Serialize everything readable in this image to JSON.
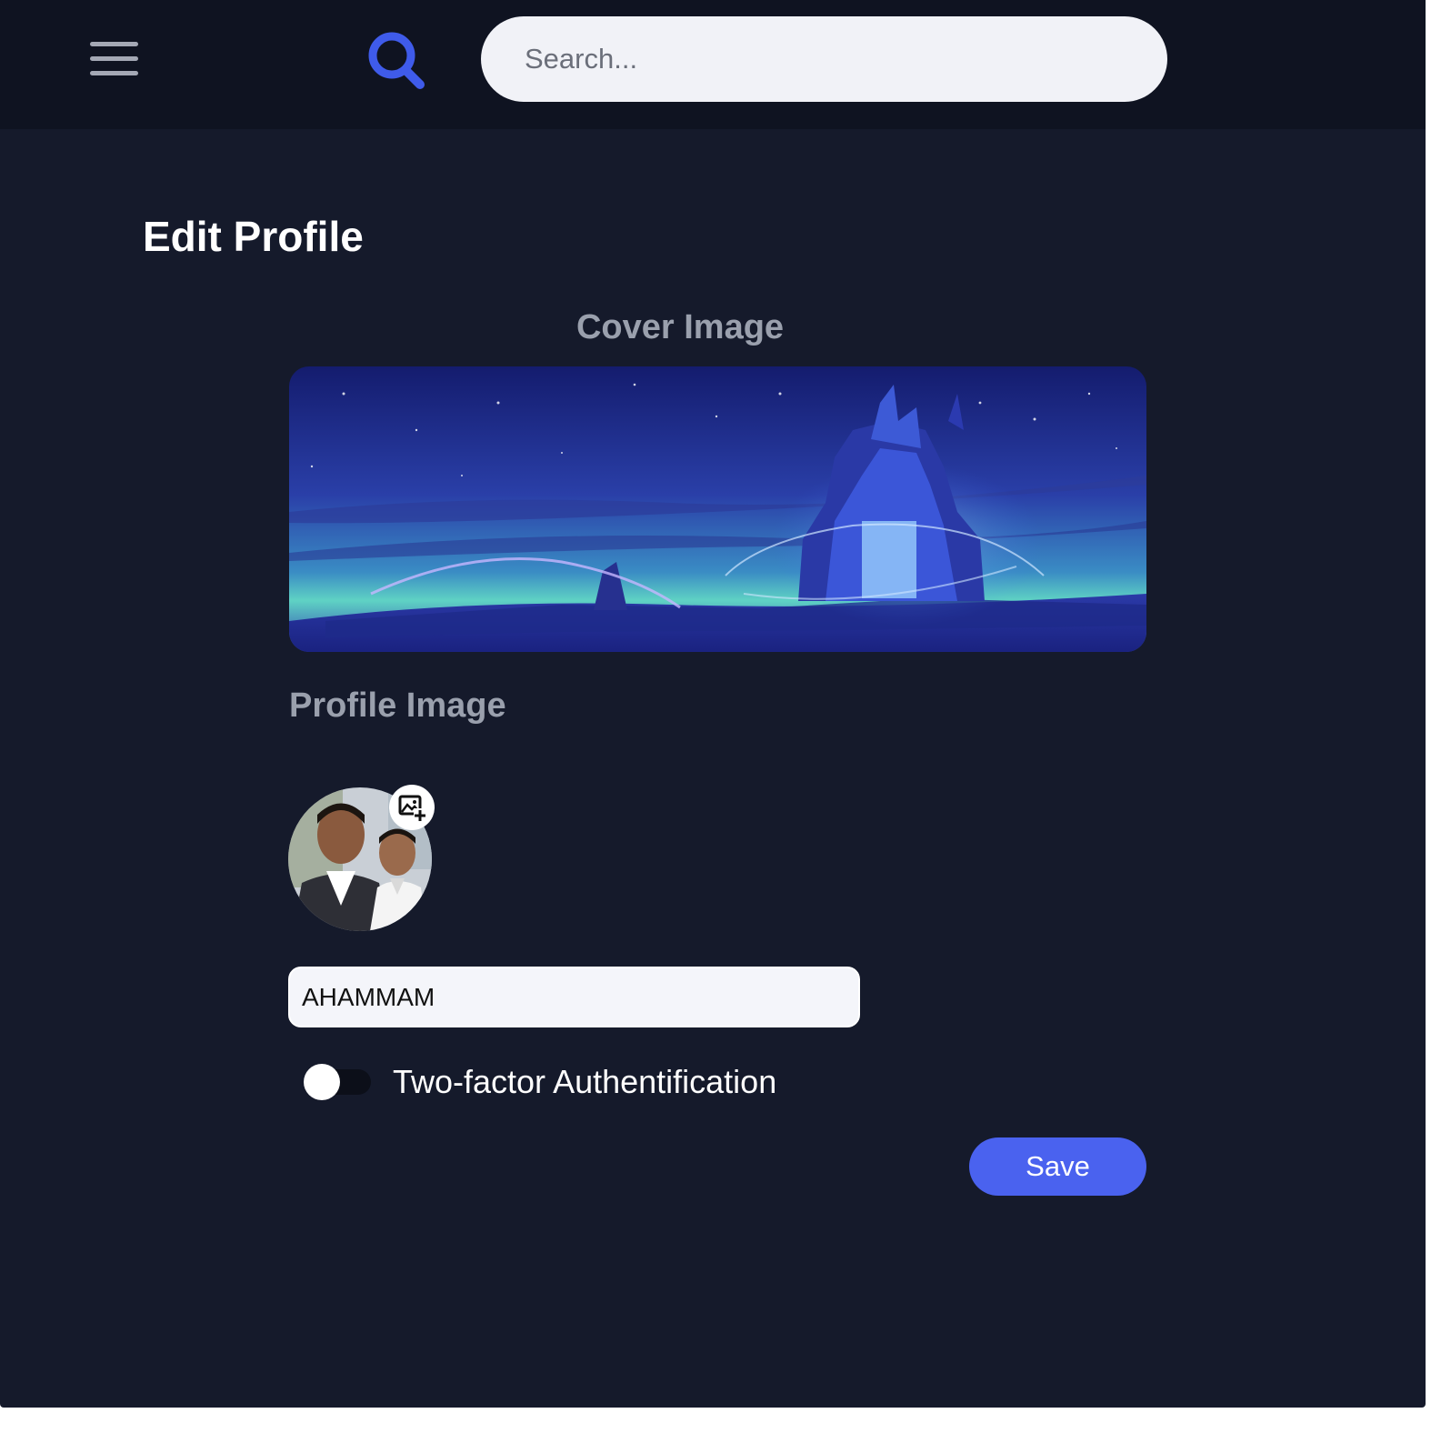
{
  "header": {
    "menu_icon": "hamburger-menu-icon",
    "search_icon": "search-icon",
    "search_placeholder": "Search...",
    "search_value": ""
  },
  "main": {
    "title": "Edit Profile",
    "cover_label": "Cover Image",
    "profile_label": "Profile Image",
    "avatar_edit_icon": "add-photo-icon",
    "name_value": "AHAMMAM",
    "two_factor_label": "Two-factor Authentification",
    "two_factor_enabled": false,
    "save_label": "Save"
  },
  "colors": {
    "background": "#151a2b",
    "topbar": "#0f1321",
    "accent": "#4a62ef",
    "muted_label": "#9aa0ad"
  }
}
